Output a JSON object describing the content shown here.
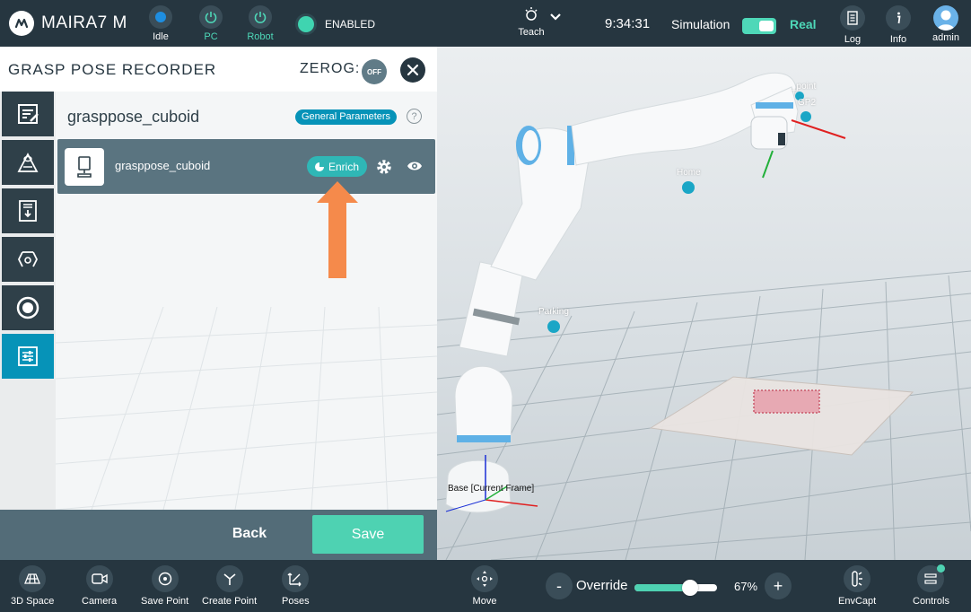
{
  "topbar": {
    "brand": "MAIRA7 M",
    "idle_label": "Idle",
    "pc_label": "PC",
    "robot_label": "Robot",
    "enabled_label": "ENABLED",
    "teach_label": "Teach",
    "time": "9:34:31",
    "simulation_label": "Simulation",
    "real_label": "Real",
    "log_label": "Log",
    "info_label": "Info",
    "user_label": "admin"
  },
  "panel": {
    "title": "GRASP POSE RECORDER",
    "zerog_label": "ZEROG:",
    "zerog_state": "OFF",
    "project_name": "grasppose_cuboid",
    "general_params_label": "General Parameters",
    "help_glyph": "?",
    "item": {
      "name": "grasppose_cuboid",
      "enrich_label": "Enrich"
    },
    "back_label": "Back",
    "save_label": "Save"
  },
  "viewport": {
    "points": {
      "tcp": "_point",
      "gp2": "GP2",
      "home": "Home",
      "parking": "Parking"
    },
    "frame_label": "Base [Current Frame]"
  },
  "bottombar": {
    "space_3d_label": "3D Space",
    "camera_label": "Camera",
    "save_point_label": "Save Point",
    "create_point_label": "Create Point",
    "poses_label": "Poses",
    "move_label": "Move",
    "override_minus": "-",
    "override_label": "Override",
    "override_value": 67,
    "override_text": "67%",
    "override_plus": "+",
    "envcapt_label": "EnvCapt",
    "controls_label": "Controls"
  },
  "colors": {
    "accent_teal": "#4ed2b2",
    "accent_blue": "#0693b8",
    "dark_bar": "#263640",
    "annotation_arrow": "#f58a4b"
  }
}
